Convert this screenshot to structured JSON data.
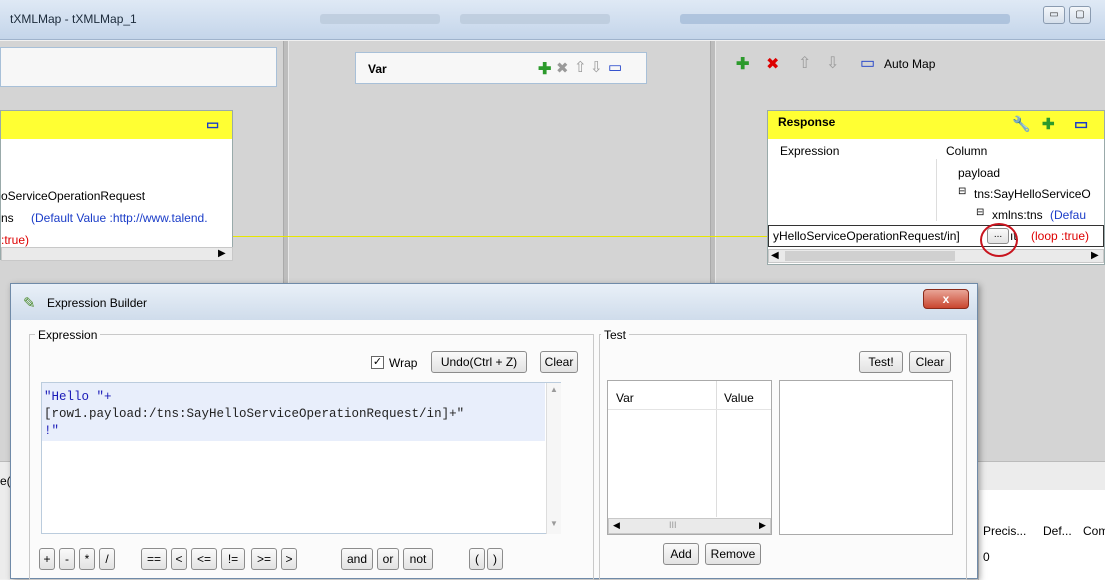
{
  "window": {
    "title": "tXMLMap - tXMLMap_1",
    "min_glyph": "▭",
    "max_glyph": "▢"
  },
  "var_panel": {
    "title": "Var"
  },
  "right_toolbar": {
    "auto_map": "Auto Map"
  },
  "left_table": {
    "row1": "oServiceOperationRequest",
    "row2_prefix": "ns",
    "row2_default": "(Default Value :http://www.talend.",
    "row3": ":true)"
  },
  "response": {
    "title": "Response",
    "col_expression": "Expression",
    "col_column": "Column",
    "tree": [
      "payload",
      "tns:SayHelloServiceO",
      "xmlns:tns"
    ],
    "default_label": "(Defau",
    "edit_value": "yHelloServiceOperationRequest/in]",
    "ellipsis": "...",
    "loop_prefix": "ıt",
    "loop": "(loop :true)"
  },
  "expression_builder": {
    "title": "Expression Builder",
    "close_label": "x",
    "expression_group": "Expression",
    "wrap_label": "Wrap",
    "wrap_checked": true,
    "undo_label": "Undo(Ctrl + Z)",
    "clear_label": "Clear",
    "expression_lines": [
      "\"Hello \"+",
      "[row1.payload:/tns:SayHelloServiceOperationRequest/in]+\"",
      "!\""
    ],
    "operators": [
      "+",
      "-",
      "*",
      "/",
      "==",
      "<",
      "<=",
      "!=",
      ">=",
      ">",
      "and",
      "or",
      "not",
      "(",
      ")"
    ],
    "test_group": "Test",
    "test_button": "Test!",
    "test_clear": "Clear",
    "var_header": "Var",
    "value_header": "Value",
    "add_label": "Add",
    "remove_label": "Remove",
    "scroll_dots": "III"
  },
  "background_table": {
    "headers": [
      "Precis...",
      "Def...",
      "Com"
    ],
    "value": "0",
    "side_label": "e("
  }
}
